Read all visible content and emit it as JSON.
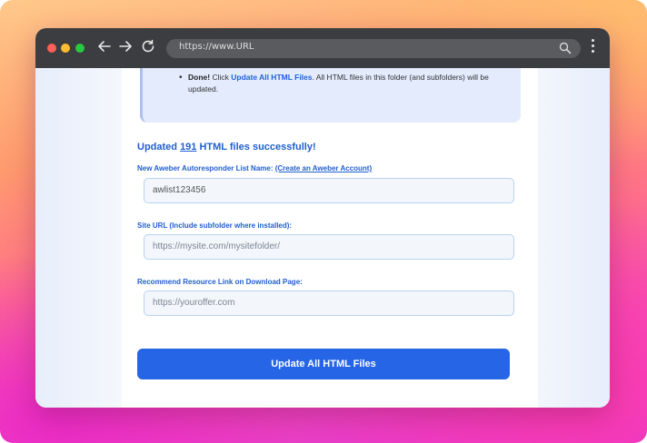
{
  "browser": {
    "url": "https://www.URL"
  },
  "notice": {
    "done_label": "Done!",
    "text_before_link": " Click ",
    "link_label": "Update All HTML Files",
    "text_after_link": ". All HTML files in this folder (and subfolders) will be updated."
  },
  "status": {
    "prefix": "Updated ",
    "count": "191",
    "suffix": " HTML files successfully!"
  },
  "form": {
    "list_name_label": "New Aweber Autoresponder List Name: ",
    "create_account_link": "(Create an Aweber Account)",
    "list_name_value": "awlist123456",
    "site_url_label": "Site URL (Include subfolder where installed):",
    "site_url_placeholder": "https://mysite.com/mysitefolder/",
    "resource_label": "Recommend Resource Link on Download Page:",
    "resource_placeholder": "https://youroffer.com",
    "submit_label": "Update All HTML Files"
  }
}
